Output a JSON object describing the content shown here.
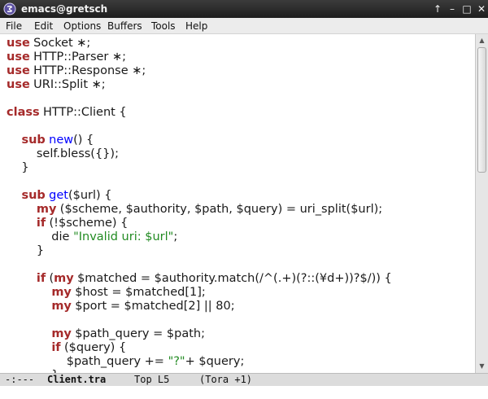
{
  "window": {
    "title": "emacs@gretsch",
    "controls": [
      "↑",
      "–",
      "□",
      "✕"
    ]
  },
  "menu": [
    "File",
    "Edit",
    "Options",
    "Buffers",
    "Tools",
    "Help"
  ],
  "code": [
    [
      [
        "kw",
        "use"
      ],
      [
        "",
        "Socket ∗;"
      ]
    ],
    [
      [
        "kw",
        "use"
      ],
      [
        "",
        "HTTP::Parser ∗;"
      ]
    ],
    [
      [
        "kw",
        "use"
      ],
      [
        "",
        "HTTP::Response ∗;"
      ]
    ],
    [
      [
        "kw",
        "use"
      ],
      [
        "",
        "URI::Split ∗;"
      ]
    ],
    [],
    [
      [
        "kw",
        "class"
      ],
      [
        "",
        "HTTP::Client {"
      ]
    ],
    [],
    [
      [
        "",
        "    "
      ],
      [
        "kw",
        "sub"
      ],
      [
        "",
        ""
      ],
      [
        "fn",
        "new"
      ],
      [
        "",
        "() {"
      ]
    ],
    [
      [
        "",
        "        self.bless({});"
      ]
    ],
    [
      [
        "",
        "    }"
      ]
    ],
    [],
    [
      [
        "",
        "    "
      ],
      [
        "kw",
        "sub"
      ],
      [
        "",
        ""
      ],
      [
        "fn",
        "get"
      ],
      [
        "",
        "($url) {"
      ]
    ],
    [
      [
        "",
        "        "
      ],
      [
        "kw",
        "my"
      ],
      [
        "",
        "($scheme, $authority, $path, $query) = uri_split($url);"
      ]
    ],
    [
      [
        "",
        "        "
      ],
      [
        "kw",
        "if"
      ],
      [
        "",
        "(!$scheme) {"
      ]
    ],
    [
      [
        "",
        "            die "
      ],
      [
        "str",
        "\"Invalid uri: $url\""
      ],
      [
        "",
        ";"
      ]
    ],
    [
      [
        "",
        "        }"
      ]
    ],
    [],
    [
      [
        "",
        "        "
      ],
      [
        "kw",
        "if"
      ],
      [
        "",
        "("
      ],
      [
        "kw",
        "my"
      ],
      [
        "",
        "$matched = $authority.match(/^(.+)(?::(¥d+))?$/)) {"
      ]
    ],
    [
      [
        "",
        "            "
      ],
      [
        "kw",
        "my"
      ],
      [
        "",
        "$host = $matched[1];"
      ]
    ],
    [
      [
        "",
        "            "
      ],
      [
        "kw",
        "my"
      ],
      [
        "",
        "$port = $matched[2] || 80;"
      ]
    ],
    [],
    [
      [
        "",
        "            "
      ],
      [
        "kw",
        "my"
      ],
      [
        "",
        "$path_query = $path;"
      ]
    ],
    [
      [
        "",
        "            "
      ],
      [
        "kw",
        "if"
      ],
      [
        "",
        "($query) {"
      ]
    ],
    [
      [
        "",
        "                $path_query += "
      ],
      [
        "str",
        "\"?\""
      ],
      [
        "",
        "+ $query;"
      ]
    ],
    [
      [
        "",
        "            }"
      ]
    ]
  ],
  "modeline": {
    "status": "-:---",
    "buffer": "Client.tra",
    "position": "Top L5",
    "mode": "(Tora +1)"
  },
  "colors": {
    "keyword": "#a52a2a",
    "function": "#0000ff",
    "string": "#228b22"
  }
}
